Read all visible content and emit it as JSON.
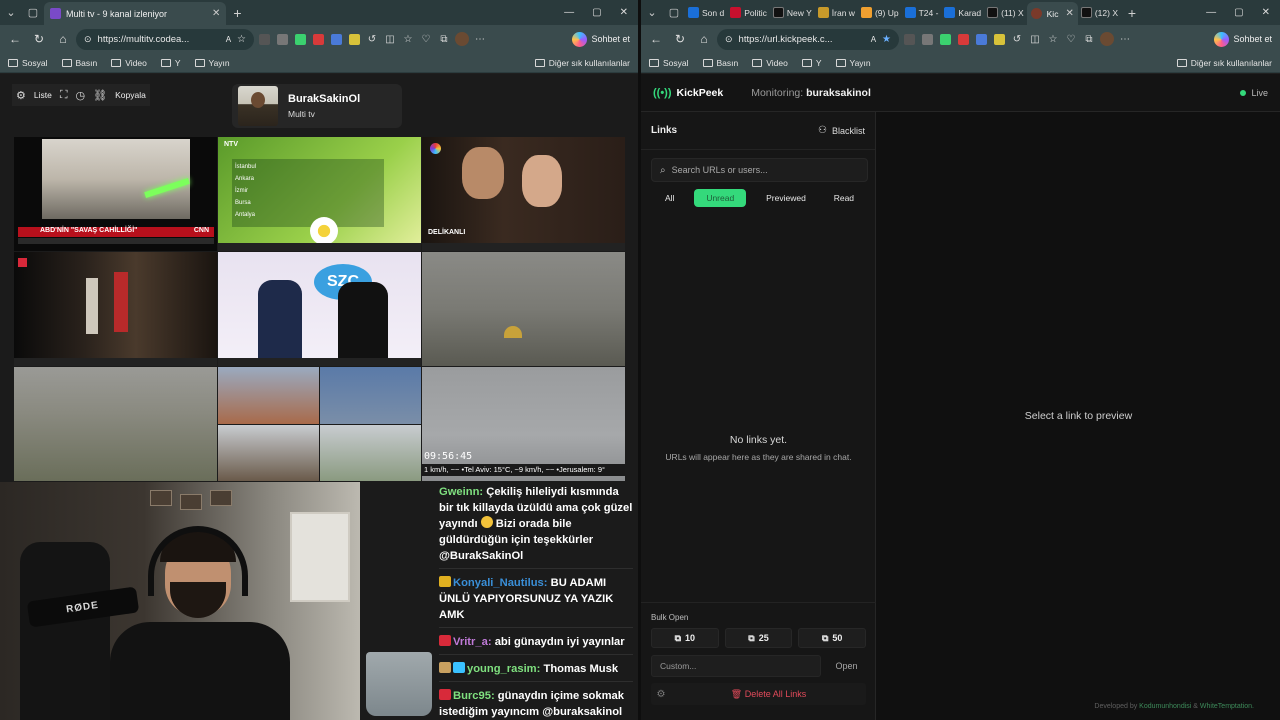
{
  "left": {
    "tab_title": "Multi tv - 9 kanal izleniyor",
    "url": "https://multitv.codea...",
    "chat_button": "Sohbet et",
    "bookmarks": [
      "Sosyal",
      "Basın",
      "Video",
      "Y",
      "Yayın"
    ],
    "other_bookmarks": "Diğer sık kullanılanlar",
    "toolbar": {
      "list": "Liste",
      "copy": "Kopyala"
    },
    "channel": {
      "name": "BurakSakinOl",
      "subtitle": "Multi tv"
    },
    "tiles": {
      "t1_headline": "ABD'NİN \"SAVAŞ CAHİLLİĞİ\"",
      "t1_logo": "CNN",
      "t2_logo": "NTV",
      "t2_cities": [
        "İstanbul",
        "Ankara",
        "İzmir",
        "Bursa",
        "Antalya"
      ],
      "t3_show": "DELİKANLI",
      "t5_logo": "SZC",
      "t9_clock": "09:56:45",
      "t9_ticker": "1 km/h, ~~ •Tel Aviv: 15°C, ~9 km/h, ~~ •Jerusalem: 9°"
    },
    "chat": [
      {
        "user": "Gweinn",
        "user_color": "#7fe07f",
        "text": "Çekiliş hileliydi kısmında bir tık killayda üzüldü ama çok güzel yayındı",
        "text2": "Bizi orada bile güldürdüğün için teşekkürler @BurakSakinOl"
      },
      {
        "user": "Konyali_Nautilus",
        "user_color": "#3a8fd8",
        "text": "BU ADAMI ÜNLÜ YAPIYORSUNUZ YA YAZIK AMK"
      },
      {
        "user": "Vritr_a",
        "user_color": "#c07ad8",
        "text": "abi günaydın iyi yayınlar"
      },
      {
        "user": "young_rasim",
        "user_color": "#7fe07f",
        "text": "Thomas Musk"
      },
      {
        "user": "Burc95",
        "user_color": "#7fe07f",
        "text": "günaydın içime sokmak istediğim yayıncım @buraksakinol"
      }
    ]
  },
  "right": {
    "tabs": [
      {
        "label": "Son d",
        "color": "#1a6fd8"
      },
      {
        "label": "Politic",
        "color": "#c8102e"
      },
      {
        "label": "New Y",
        "color": "#111111"
      },
      {
        "label": "İran w",
        "color": "#c89a2a"
      },
      {
        "label": "(9) Up",
        "color": "#f0a030"
      },
      {
        "label": "T24 -",
        "color": "#1a6fd8"
      },
      {
        "label": "Karad",
        "color": "#1a6fd8"
      },
      {
        "label": "(11) X",
        "color": "#111111"
      },
      {
        "label": "Kic",
        "color": "#7a3a2a"
      },
      {
        "label": "(12) X",
        "color": "#111111"
      }
    ],
    "url": "https://url.kickpeek.c...",
    "chat_button": "Sohbet et",
    "bookmarks": [
      "Sosyal",
      "Basın",
      "Video",
      "Y",
      "Yayın"
    ],
    "other_bookmarks": "Diğer sık kullanılanlar",
    "app": {
      "name": "KickPeek",
      "monitoring_label": "Monitoring:",
      "monitoring_user": "buraksakinol",
      "status": "Live",
      "links_title": "Links",
      "blacklist": "Blacklist",
      "search_placeholder": "Search URLs or users...",
      "filters": [
        "All",
        "Unread",
        "Previewed",
        "Read"
      ],
      "active_filter": "Unread",
      "empty_title": "No links yet.",
      "empty_sub": "URLs will appear here as they are shared in chat.",
      "bulk_label": "Bulk Open",
      "bulk_buttons": [
        "10",
        "25",
        "50"
      ],
      "custom_placeholder": "Custom...",
      "open_button": "Open",
      "delete_all": "Delete All Links",
      "preview_message": "Select a link to preview",
      "credit_prefix": "Developed by",
      "credit_a": "Kodumunhondisi",
      "credit_mid": "&",
      "credit_b": "WhiteTemptation."
    },
    "accent": "#34d97b",
    "danger": "#e24a5a"
  }
}
